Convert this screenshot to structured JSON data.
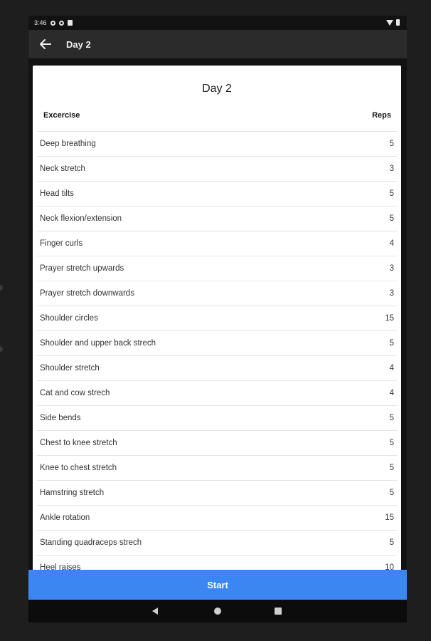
{
  "status_bar": {
    "time": "3:46",
    "icons": [
      "gear-icon",
      "settings-icon",
      "sd-card-icon",
      "wifi-icon",
      "battery-icon"
    ]
  },
  "app_bar": {
    "title": "Day 2",
    "back_icon": "arrow-left-icon"
  },
  "card": {
    "title": "Day 2",
    "columns": {
      "exercise": "Excercise",
      "reps": "Reps"
    },
    "rows": [
      {
        "name": "Deep breathing",
        "reps": "5"
      },
      {
        "name": "Neck stretch",
        "reps": "3"
      },
      {
        "name": "Head tilts",
        "reps": "5"
      },
      {
        "name": "Neck flexion/extension",
        "reps": "5"
      },
      {
        "name": "Finger curls",
        "reps": "4"
      },
      {
        "name": "Prayer stretch upwards",
        "reps": "3"
      },
      {
        "name": "Prayer stretch downwards",
        "reps": "3"
      },
      {
        "name": "Shoulder circles",
        "reps": "15"
      },
      {
        "name": "Shoulder and upper back strech",
        "reps": "5"
      },
      {
        "name": "Shoulder stretch",
        "reps": "4"
      },
      {
        "name": "Cat and cow strech",
        "reps": "4"
      },
      {
        "name": "Side bends",
        "reps": "5"
      },
      {
        "name": "Chest to knee stretch",
        "reps": "5"
      },
      {
        "name": "Knee to chest stretch",
        "reps": "5"
      },
      {
        "name": "Hamstring stretch",
        "reps": "5"
      },
      {
        "name": "Ankle rotation",
        "reps": "15"
      },
      {
        "name": "Standing quadraceps strech",
        "reps": "5"
      },
      {
        "name": "Heel raises",
        "reps": "10"
      }
    ]
  },
  "start_button": {
    "label": "Start"
  },
  "nav_bar": {
    "icons": [
      "back-triangle-icon",
      "home-circle-icon",
      "recents-square-icon"
    ]
  },
  "colors": {
    "accent": "#3b86f0",
    "app_bar": "#2b2b2b",
    "background": "#1e1e1e"
  }
}
